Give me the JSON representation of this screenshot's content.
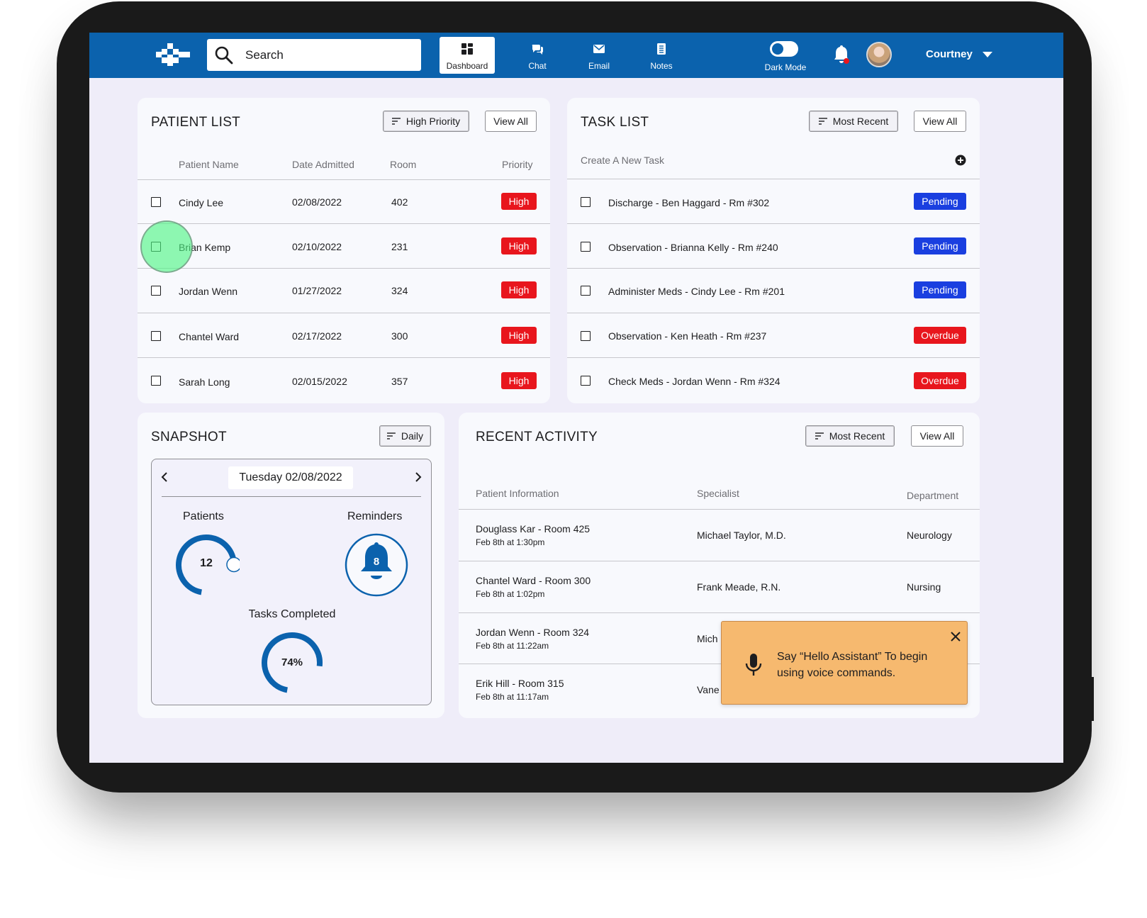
{
  "nav": {
    "search_placeholder": "Search",
    "items": [
      {
        "label": "Dashboard",
        "icon": "dashboard-icon",
        "active": true
      },
      {
        "label": "Chat",
        "icon": "chat-icon"
      },
      {
        "label": "Email",
        "icon": "email-icon"
      },
      {
        "label": "Notes",
        "icon": "notes-icon"
      }
    ],
    "dark_mode_label": "Dark Mode",
    "user_name": "Courtney"
  },
  "patient_list": {
    "title": "PATIENT LIST",
    "filter_label": "High Priority",
    "view_all_label": "View All",
    "columns": [
      "Patient Name",
      "Date Admitted",
      "Room",
      "Priority"
    ],
    "rows": [
      {
        "name": "Cindy Lee",
        "date": "02/08/2022",
        "room": "402",
        "priority": "High"
      },
      {
        "name": "Brian Kemp",
        "date": "02/10/2022",
        "room": "231",
        "priority": "High"
      },
      {
        "name": "Jordan Wenn",
        "date": "01/27/2022",
        "room": "324",
        "priority": "High"
      },
      {
        "name": "Chantel Ward",
        "date": "02/17/2022",
        "room": "300",
        "priority": "High"
      },
      {
        "name": "Sarah Long",
        "date": "02/015/2022",
        "room": "357",
        "priority": "High"
      }
    ]
  },
  "task_list": {
    "title": "TASK LIST",
    "filter_label": "Most Recent",
    "view_all_label": "View All",
    "create_label": "Create A New Task",
    "rows": [
      {
        "task": "Discharge - Ben Haggard - Rm #302",
        "status": "Pending"
      },
      {
        "task": "Observation - Brianna Kelly - Rm #240",
        "status": "Pending"
      },
      {
        "task": "Administer Meds - Cindy Lee - Rm #201",
        "status": "Pending"
      },
      {
        "task": "Observation - Ken Heath - Rm #237",
        "status": "Overdue"
      },
      {
        "task": "Check Meds - Jordan Wenn - Rm #324",
        "status": "Overdue"
      }
    ]
  },
  "snapshot": {
    "title": "SNAPSHOT",
    "filter_label": "Daily",
    "date_label": "Tuesday 02/08/2022",
    "patients_label": "Patients",
    "patients_value": "12",
    "patients_progress": 0.72,
    "reminders_label": "Reminders",
    "reminders_value": "8",
    "tasks_label": "Tasks Completed",
    "tasks_value": "74%",
    "tasks_progress": 0.74
  },
  "recent_activity": {
    "title": "RECENT ACTIVITY",
    "filter_label": "Most Recent",
    "view_all_label": "View All",
    "columns": [
      "Patient Information",
      "Specialist",
      "Department"
    ],
    "rows": [
      {
        "patient": "Douglass Kar - Room 425",
        "time": "Feb 8th at 1:30pm",
        "specialist": "Michael Taylor, M.D.",
        "department": "Neurology"
      },
      {
        "patient": "Chantel Ward - Room 300",
        "time": "Feb 8th at 1:02pm",
        "specialist": "Frank Meade, R.N.",
        "department": "Nursing"
      },
      {
        "patient": "Jordan Wenn - Room 324",
        "time": "Feb 8th at 11:22am",
        "specialist": "Mich",
        "department": ""
      },
      {
        "patient": "Erik Hill - Room 315",
        "time": "Feb 8th at 11:17am",
        "specialist": "Vane",
        "department": ""
      }
    ]
  },
  "toast": {
    "message": "Say “Hello Assistant” To begin using voice commands."
  },
  "colors": {
    "brand_blue": "#0b62ad",
    "high": "#e8161d",
    "pending": "#1a3fe0",
    "toast": "#f6b96f"
  }
}
